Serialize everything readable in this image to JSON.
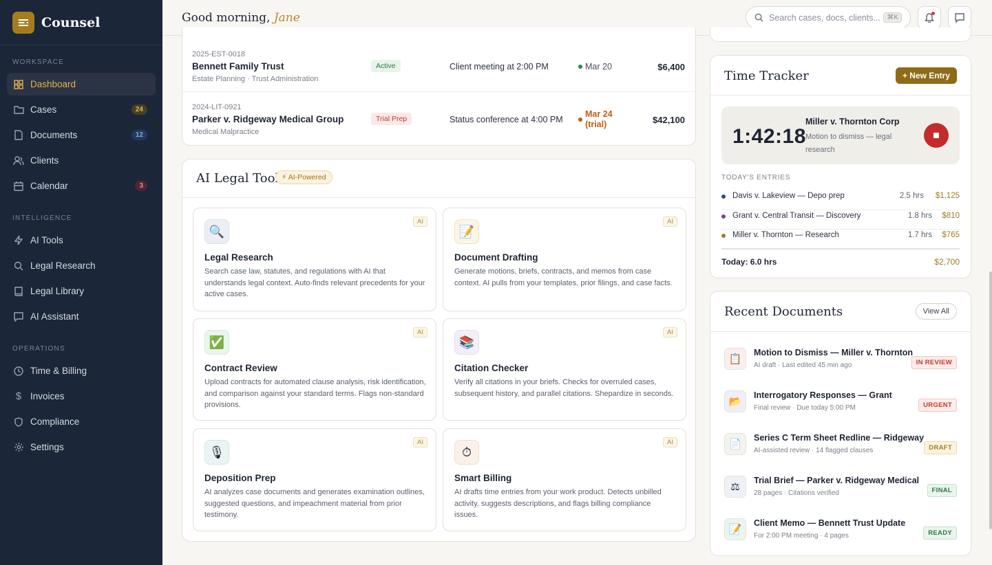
{
  "brand": {
    "name": "Counsel"
  },
  "sidebar": {
    "sections": [
      {
        "label": "WORKSPACE"
      },
      {
        "label": "INTELLIGENCE"
      },
      {
        "label": "OPERATIONS"
      }
    ],
    "workspace": [
      {
        "label": "Dashboard",
        "icon": "grid-icon",
        "active": true
      },
      {
        "label": "Cases",
        "icon": "folder-icon",
        "badge": "24"
      },
      {
        "label": "Documents",
        "icon": "document-icon",
        "badge": "12"
      },
      {
        "label": "Clients",
        "icon": "users-icon"
      },
      {
        "label": "Calendar",
        "icon": "calendar-icon",
        "badge": "3"
      }
    ],
    "intelligence": [
      {
        "label": "AI Tools",
        "icon": "bolt-icon"
      },
      {
        "label": "Legal Research",
        "icon": "search-icon"
      },
      {
        "label": "Legal Library",
        "icon": "book-icon"
      },
      {
        "label": "AI Assistant",
        "icon": "chat-icon"
      }
    ],
    "operations": [
      {
        "label": "Time & Billing",
        "icon": "clock-icon"
      },
      {
        "label": "Invoices",
        "icon": "dollar-icon"
      },
      {
        "label": "Compliance",
        "icon": "shield-icon"
      },
      {
        "label": "Settings",
        "icon": "gear-icon"
      }
    ]
  },
  "topbar": {
    "greeting": "Good morning,",
    "user": "Jane",
    "search_placeholder": "Search cases, docs, clients...",
    "search_shortcut": "⌘K"
  },
  "cases": [
    {
      "number": "2025-EST-0018",
      "title": "Bennett Family Trust",
      "sub": "Estate Planning · Trust Administration",
      "status": "Active",
      "next": "Client meeting at 2:00 PM",
      "date": "Mar 20",
      "amount": "$6,400"
    },
    {
      "number": "2024-LIT-0921",
      "title": "Parker v. Ridgeway Medical Group",
      "sub": "Medical Malpractice",
      "status": "Trial Prep",
      "next": "Status conference at 4:00 PM",
      "date_line1": "Mar 24",
      "date_line2": "(trial)",
      "amount": "$42,100"
    }
  ],
  "ai_tools": {
    "title": "AI Legal Tools",
    "badge": "AI-Powered",
    "tag": "AI",
    "items": [
      {
        "title": "Legal Research",
        "desc": "Search case law, statutes, and regulations with AI that understands legal context. Auto-finds relevant precedents for your active cases.",
        "icon": "🔍"
      },
      {
        "title": "Document Drafting",
        "desc": "Generate motions, briefs, contracts, and memos from case context. AI pulls from your templates, prior filings, and case facts.",
        "icon": "📝"
      },
      {
        "title": "Contract Review",
        "desc": "Upload contracts for automated clause analysis, risk identification, and comparison against your standard terms. Flags non-standard provisions.",
        "icon": "✅"
      },
      {
        "title": "Citation Checker",
        "desc": "Verify all citations in your briefs. Checks for overruled cases, subsequent history, and parallel citations. Shepardize in seconds.",
        "icon": "📚"
      },
      {
        "title": "Deposition Prep",
        "desc": "AI analyzes case documents and generates examination outlines, suggested questions, and impeachment material from prior testimony.",
        "icon": "🎙"
      },
      {
        "title": "Smart Billing",
        "desc": "AI drafts time entries from your work product. Detects unbilled activity, suggests descriptions, and flags billing compliance issues.",
        "icon": "⏱"
      }
    ]
  },
  "time_tracker": {
    "title": "Time Tracker",
    "new_entry": "+ New Entry",
    "timer": "1:42:18",
    "case": "Miller v. Thornton Corp",
    "task": "Motion to dismiss — legal research",
    "entries_label": "TODAY'S ENTRIES",
    "entries": [
      {
        "label": "Davis v. Lakeview — Depo prep",
        "hours": "2.5 hrs",
        "amount": "$1,125",
        "color": "#2e4a8c"
      },
      {
        "label": "Grant v. Central Transit — Discovery",
        "hours": "1.8 hrs",
        "amount": "$810",
        "color": "#7a3aa8"
      },
      {
        "label": "Miller v. Thornton — Research",
        "hours": "1.7 hrs",
        "amount": "$765",
        "color": "#a57d1f"
      }
    ],
    "total_label": "Today: 6.0 hrs",
    "total_amount": "$2,700"
  },
  "recent_docs": {
    "title": "Recent Documents",
    "view_all": "View All",
    "items": [
      {
        "title": "Motion to Dismiss — Miller v. Thornton",
        "sub": "AI draft · Last edited 45 min ago",
        "status": "IN REVIEW",
        "icon": "📋"
      },
      {
        "title": "Interrogatory Responses — Grant",
        "sub": "Final review · Due today 5:00 PM",
        "status": "URGENT",
        "icon": "📂"
      },
      {
        "title": "Series C Term Sheet Redline — Ridgeway",
        "sub": "AI-assisted review · 14 flagged clauses",
        "status": "DRAFT",
        "icon": "📄"
      },
      {
        "title": "Trial Brief — Parker v. Ridgeway Medical",
        "sub": "28 pages · Citations verified",
        "status": "FINAL",
        "icon": "⚖"
      },
      {
        "title": "Client Memo — Bennett Trust Update",
        "sub": "For 2:00 PM meeting · 4 pages",
        "status": "READY",
        "icon": "📝"
      }
    ]
  },
  "colors": {
    "accent": "#a57d1f",
    "sidebar": "#1b2638",
    "danger": "#c42b2b"
  }
}
